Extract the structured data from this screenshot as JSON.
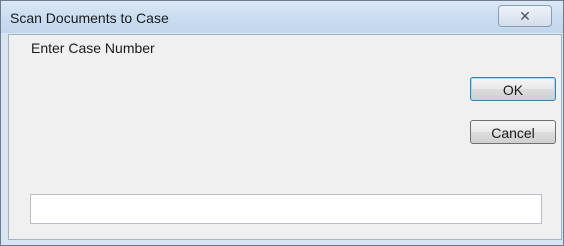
{
  "window": {
    "title": "Scan Documents to Case",
    "close_glyph": "✕"
  },
  "dialog": {
    "prompt_label": "Enter Case Number",
    "ok_label": "OK",
    "cancel_label": "Cancel",
    "case_number_value": "",
    "case_number_placeholder": ""
  }
}
